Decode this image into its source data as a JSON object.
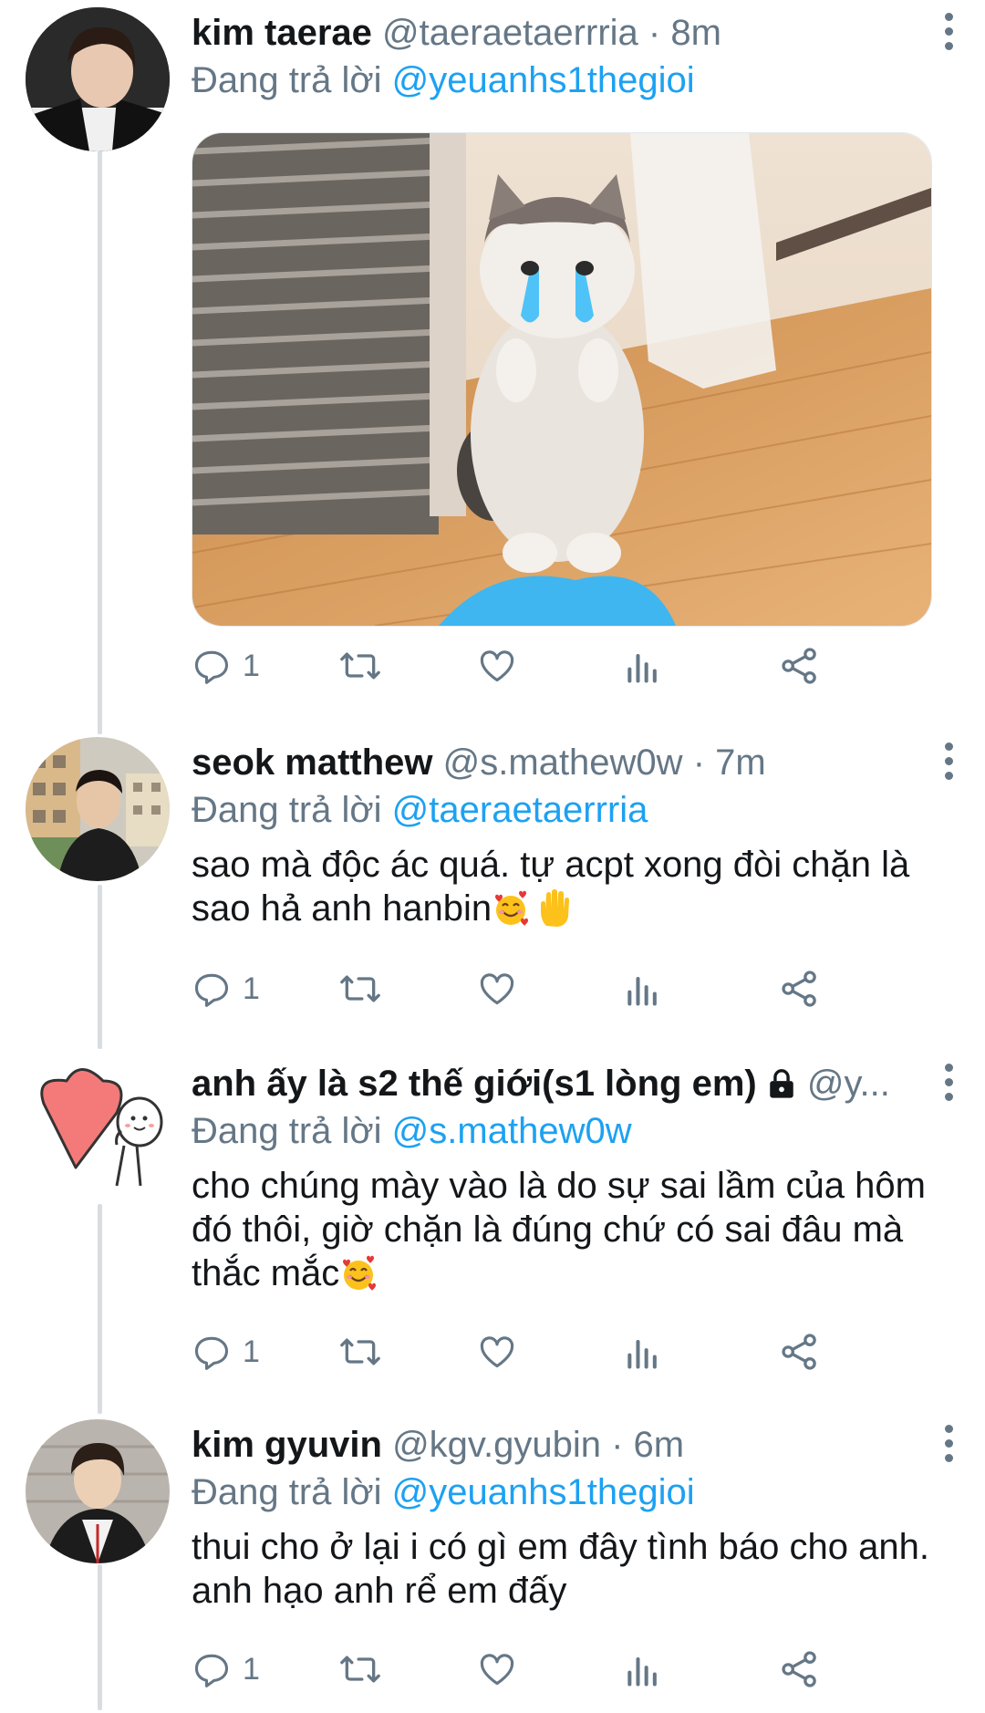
{
  "replying_label": "Đang trả lời",
  "tweets": [
    {
      "name": "kim taerae",
      "handle": "@taeraetaerrria",
      "time": "8m",
      "replying_to": "@yeuanhs1thegioi",
      "text": "",
      "replies": "1",
      "media": "cat-photo"
    },
    {
      "name": "seok matthew",
      "handle": "@s.mathew0w",
      "time": "7m",
      "replying_to": "@taeraetaerrria",
      "text": "sao mà độc ác quá. tự acpt xong đòi chặn là sao hả anh hanbin",
      "replies": "1"
    },
    {
      "name": "anh ấy là s2 thế giới(s1 lòng em)",
      "handle": "@y...",
      "time": "",
      "replying_to": "@s.mathew0w",
      "text": "cho chúng mày vào là do sự sai lầm của hôm đó thôi, giờ chặn là đúng chứ có sai đâu mà thắc mắc",
      "replies": "1"
    },
    {
      "name": "kim gyuvin",
      "handle": "@kgv.gyubin",
      "time": "6m",
      "replying_to": "@yeuanhs1thegioi",
      "text": "thui cho ở lại i có gì em đây tình báo cho anh. anh hạo anh rể em đấy",
      "replies": "1"
    }
  ],
  "colors": {
    "link": "#1da1f2",
    "secondary": "#657786",
    "thread_line": "#d9dde1"
  },
  "icons": [
    "reply-icon",
    "retweet-icon",
    "like-icon",
    "analytics-icon",
    "share-icon",
    "more-icon",
    "lock-icon"
  ]
}
